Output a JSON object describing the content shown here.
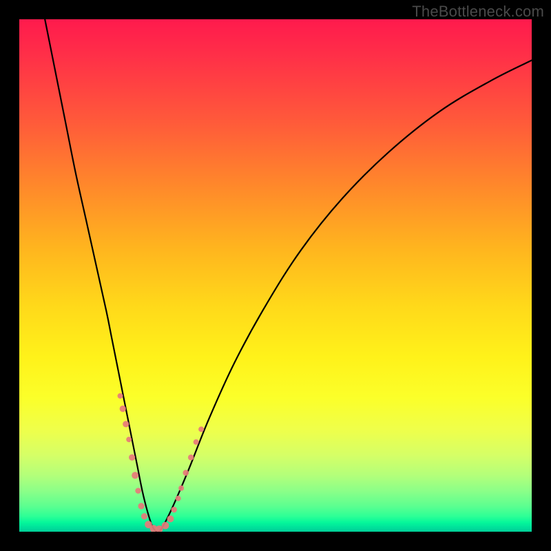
{
  "watermark": "TheBottleneck.com",
  "colors": {
    "curve_stroke": "#000000",
    "dot_fill": "#e77a7a",
    "frame_bg": "#000000"
  },
  "chart_data": {
    "type": "line",
    "title": "",
    "xlabel": "",
    "ylabel": "",
    "xlim": [
      0,
      100
    ],
    "ylim": [
      0,
      100
    ],
    "series": [
      {
        "name": "bottleneck-curve",
        "x": [
          5,
          7,
          9,
          11,
          13,
          15,
          17,
          18,
          19,
          20,
          21,
          22,
          23,
          24,
          25,
          26,
          27,
          28,
          30,
          33,
          37,
          42,
          48,
          55,
          63,
          72,
          82,
          92,
          100
        ],
        "values": [
          100,
          90,
          80,
          70,
          61,
          52,
          43,
          38,
          33,
          28,
          23,
          18,
          13,
          8,
          4,
          1,
          0,
          1,
          5,
          12,
          22,
          33,
          44,
          55,
          65,
          74,
          82,
          88,
          92
        ]
      }
    ],
    "annotations": {
      "valley_dots": [
        {
          "x": 19.7,
          "y": 26.5,
          "r": 1.0
        },
        {
          "x": 20.2,
          "y": 24.0,
          "r": 1.3
        },
        {
          "x": 20.8,
          "y": 21.0,
          "r": 1.3
        },
        {
          "x": 21.4,
          "y": 18.0,
          "r": 1.1
        },
        {
          "x": 22.0,
          "y": 14.5,
          "r": 1.3
        },
        {
          "x": 22.6,
          "y": 11.0,
          "r": 1.4
        },
        {
          "x": 23.2,
          "y": 8.0,
          "r": 1.2
        },
        {
          "x": 23.8,
          "y": 5.0,
          "r": 1.3
        },
        {
          "x": 24.4,
          "y": 3.0,
          "r": 1.3
        },
        {
          "x": 25.2,
          "y": 1.4,
          "r": 1.5
        },
        {
          "x": 26.2,
          "y": 0.6,
          "r": 1.5
        },
        {
          "x": 27.3,
          "y": 0.5,
          "r": 1.5
        },
        {
          "x": 28.5,
          "y": 1.2,
          "r": 1.5
        },
        {
          "x": 29.5,
          "y": 2.5,
          "r": 1.4
        },
        {
          "x": 30.2,
          "y": 4.3,
          "r": 1.2
        },
        {
          "x": 31.0,
          "y": 6.5,
          "r": 1.0
        },
        {
          "x": 31.6,
          "y": 8.5,
          "r": 1.0
        },
        {
          "x": 32.5,
          "y": 11.5,
          "r": 1.2
        },
        {
          "x": 33.5,
          "y": 14.5,
          "r": 1.2
        },
        {
          "x": 34.5,
          "y": 17.5,
          "r": 1.1
        },
        {
          "x": 35.5,
          "y": 20.0,
          "r": 1.0
        }
      ]
    }
  }
}
